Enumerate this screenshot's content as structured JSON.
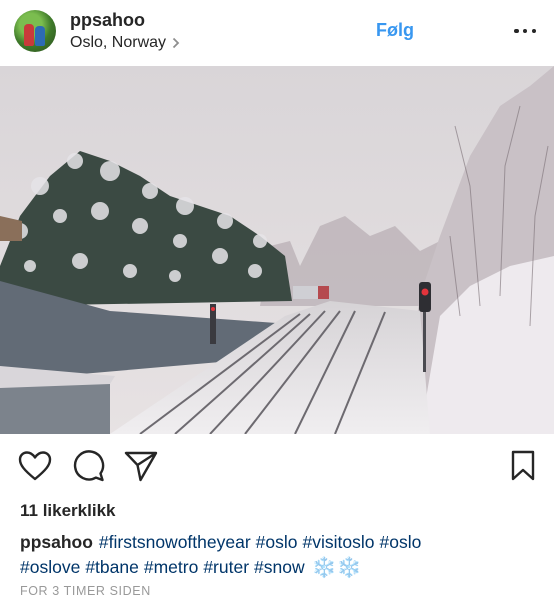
{
  "post": {
    "username": "ppsahoo",
    "location": "Oslo, Norway",
    "follow_label": "Følg",
    "likes_text": "11 likerklikk",
    "caption": {
      "username": "ppsahoo",
      "hashtags_line1": [
        "#firstsnowoftheyear",
        "#oslo",
        "#visitoslo",
        "#oslo"
      ],
      "hashtags_line2": [
        "#oslove",
        "#tbane",
        "#metro",
        "#ruter",
        "#snow"
      ],
      "emoji": "❄️❄️"
    },
    "timestamp": "FOR 3 TIMER SIDEN"
  },
  "icons": {
    "location_chevron": "chevron-right-icon",
    "more": "more-options-icon",
    "like": "heart-icon",
    "comment": "comment-bubble-icon",
    "share": "direct-send-icon",
    "save": "bookmark-icon"
  },
  "colors": {
    "follow": "#3897f0",
    "text": "#262626",
    "hashtag": "#003569",
    "timestamp": "#999999"
  }
}
